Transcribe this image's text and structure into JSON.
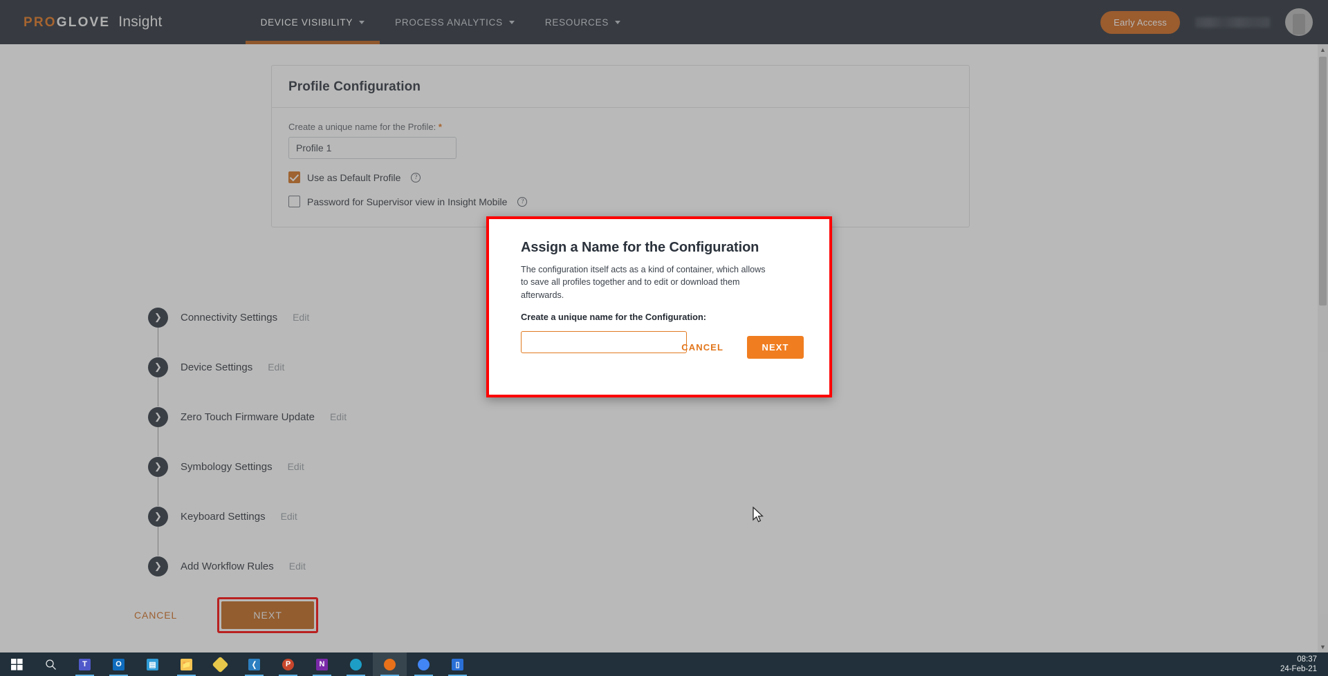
{
  "header": {
    "brand_pro": "PRO",
    "brand_glove": "GLOVE",
    "brand_product": "Insight",
    "nav": [
      {
        "label": "DEVICE VISIBILITY",
        "active": true
      },
      {
        "label": "PROCESS ANALYTICS",
        "active": false
      },
      {
        "label": "RESOURCES",
        "active": false
      }
    ],
    "early_access_label": "Early Access",
    "accent_color": "#e2721a",
    "bar_color": "#272e38"
  },
  "card": {
    "title": "Profile Configuration",
    "profile_name_label": "Create a unique name for the Profile:",
    "profile_name_required": "*",
    "profile_name_value": "Profile 1",
    "profile_name_placeholder": "",
    "default_profile_label": "Use as Default Profile",
    "default_profile_checked": true,
    "password_label": "Password for Supervisor view in Insight Mobile",
    "password_checked": false,
    "help_glyph": "?"
  },
  "steps": [
    {
      "label": "Connectivity Settings",
      "edit": "Edit"
    },
    {
      "label": "Device Settings",
      "edit": "Edit"
    },
    {
      "label": "Zero Touch Firmware Update",
      "edit": "Edit"
    },
    {
      "label": "Symbology Settings",
      "edit": "Edit"
    },
    {
      "label": "Keyboard Settings",
      "edit": "Edit"
    },
    {
      "label": "Add Workflow Rules",
      "edit": "Edit"
    }
  ],
  "actions": {
    "cancel_label": "CANCEL",
    "next_label": "NEXT",
    "highlight_color": "#ff0000"
  },
  "modal": {
    "title": "Assign a Name for the Configuration",
    "description": "The configuration itself acts as a kind of container, which allows to save all profiles together and to edit or download them afterwards.",
    "field_label": "Create a unique name for the Configuration:",
    "input_value": "",
    "input_placeholder": "",
    "cancel_label": "CANCEL",
    "next_label": "NEXT",
    "border_color": "#ff0000",
    "accent_color": "#f07d20"
  },
  "taskbar": {
    "items": [
      {
        "name": "start-button",
        "glyph": "windows"
      },
      {
        "name": "search-button",
        "glyph": "search"
      },
      {
        "name": "teams-app",
        "glyph": "T",
        "color": "#5059c9",
        "running": true
      },
      {
        "name": "outlook-app",
        "glyph": "O",
        "color": "#0f6cbd",
        "running": true
      },
      {
        "name": "contacts-app",
        "glyph": "C",
        "color": "#2f9bd6",
        "running": false
      },
      {
        "name": "file-explorer-app",
        "glyph": "F",
        "color": "#f6c453",
        "running": true
      },
      {
        "name": "sketch-app",
        "glyph": "S",
        "color": "#e8c84a",
        "running": false
      },
      {
        "name": "vscode-app",
        "glyph": "V",
        "color": "#2c7fc0",
        "running": true
      },
      {
        "name": "powerpoint-app",
        "glyph": "P",
        "color": "#c8462c",
        "running": true
      },
      {
        "name": "onenote-app",
        "glyph": "N",
        "color": "#7a29a8",
        "running": true
      },
      {
        "name": "edge-app",
        "glyph": "E",
        "color": "#1d9ec7",
        "running": true
      },
      {
        "name": "firefox-app",
        "glyph": "f",
        "color": "#e8711a",
        "running": true,
        "active": true
      },
      {
        "name": "chrome-app",
        "glyph": "G",
        "color": "#4285f4",
        "running": true
      },
      {
        "name": "trello-app",
        "glyph": "|",
        "color": "#2a6fd6",
        "running": true
      }
    ],
    "time": "08:37",
    "date": "24-Feb-21"
  },
  "scrollbar": {
    "up_glyph": "▲",
    "down_glyph": "▼"
  }
}
